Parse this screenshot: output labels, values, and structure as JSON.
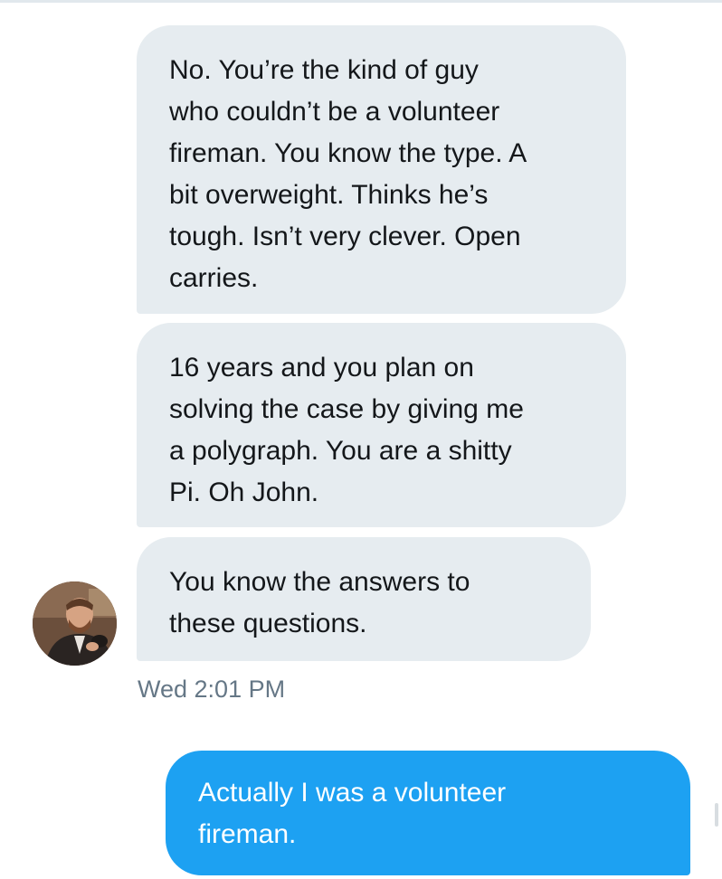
{
  "conversation": {
    "messages": [
      {
        "direction": "incoming",
        "text": "No. You’re the kind of guy\nwho couldn’t be a volunteer\nfireman. You know the type. A\nbit overweight. Thinks he’s\ntough. Isn’t very clever. Open\ncarries."
      },
      {
        "direction": "incoming",
        "text": "16 years and you plan on\nsolving the case by giving me\na polygraph. You are a shitty\nPi. Oh John."
      },
      {
        "direction": "incoming",
        "text": "You know the answers to\nthese questions."
      },
      {
        "direction": "outgoing",
        "text": "Actually I was a volunteer\nfireman."
      }
    ],
    "incoming_timestamp": "Wed 2:01 PM"
  },
  "colors": {
    "incoming_bubble": "#e6ecf0",
    "outgoing_bubble": "#1da1f2",
    "timestamp_text": "#657786"
  }
}
